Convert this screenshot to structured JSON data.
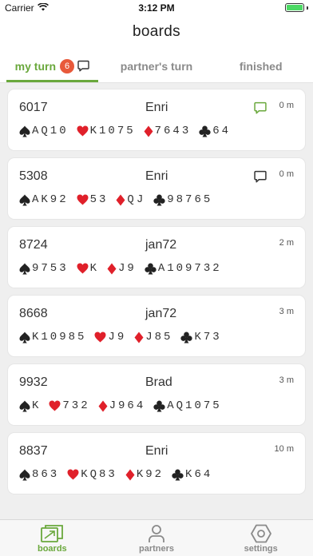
{
  "status_bar": {
    "carrier": "Carrier",
    "time": "3:12 PM"
  },
  "header": {
    "title": "boards"
  },
  "tabs": [
    {
      "label": "my turn",
      "badge": "6",
      "active": true
    },
    {
      "label": "partner's turn",
      "active": false
    },
    {
      "label": "finished",
      "active": false
    }
  ],
  "boards": [
    {
      "id": "6017",
      "partner": "Enri",
      "time": "0 m",
      "chat": "unread",
      "spades": "AQ10",
      "hearts": "K1075",
      "diamonds": "7643",
      "clubs": "64"
    },
    {
      "id": "5308",
      "partner": "Enri",
      "time": "0 m",
      "chat": "read",
      "spades": "AK92",
      "hearts": "53",
      "diamonds": "QJ",
      "clubs": "98765"
    },
    {
      "id": "8724",
      "partner": "jan72",
      "time": "2 m",
      "chat": "none",
      "spades": "9753",
      "hearts": "K",
      "diamonds": "J9",
      "clubs": "A109732"
    },
    {
      "id": "8668",
      "partner": "jan72",
      "time": "3 m",
      "chat": "none",
      "spades": "K10985",
      "hearts": "J9",
      "diamonds": "J85",
      "clubs": "K73"
    },
    {
      "id": "9932",
      "partner": "Brad",
      "time": "3 m",
      "chat": "none",
      "spades": "K",
      "hearts": "732",
      "diamonds": "J964",
      "clubs": "AQ1075"
    },
    {
      "id": "8837",
      "partner": "Enri",
      "time": "10 m",
      "chat": "none",
      "spades": "863",
      "hearts": "KQ83",
      "diamonds": "K92",
      "clubs": "K64"
    }
  ],
  "colors": {
    "accent": "#6aa83c",
    "badge": "#e8593a",
    "red_suit": "#e0202a",
    "black_suit": "#222222"
  },
  "bottom_nav": [
    {
      "label": "boards",
      "icon": "boards-icon",
      "active": true
    },
    {
      "label": "partners",
      "icon": "person-icon",
      "active": false
    },
    {
      "label": "settings",
      "icon": "hexagon-gear-icon",
      "active": false
    }
  ]
}
